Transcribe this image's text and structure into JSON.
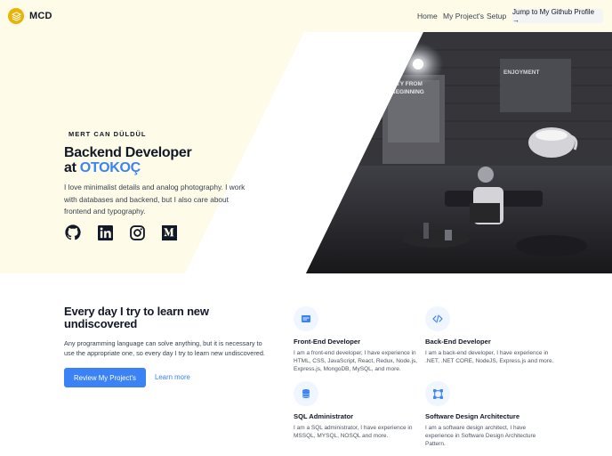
{
  "nav": {
    "logo_text": "MCD",
    "links": [
      "Home",
      "My Project's",
      "Setup"
    ],
    "cta_label": "Jump to My Github Profile →"
  },
  "hero": {
    "eyebrow": "MERT CAN DÜLDÜL",
    "title_line1": "Backend Developer",
    "title_at": "at ",
    "title_company": "OTOKOÇ",
    "description": "I love minimalist details and analog photography. I work with databases and backend, but I also care about frontend and typography.",
    "socials": [
      "github-icon",
      "linkedin-icon",
      "instagram-icon",
      "medium-icon"
    ],
    "photo_signs": {
      "left_line1": "LITY FROM",
      "left_line2": "BEGINNING",
      "right_sign": "ENJOYMENT"
    }
  },
  "section": {
    "title": "Every day I try to learn new undiscovered",
    "description": "Any programming language can solve anything, but it is necessary to use the appropriate one, so every day I try to learn new undiscovered.",
    "primary_button": "Review My Project's",
    "secondary_link": "Learn more",
    "features": [
      {
        "icon": "browser-icon",
        "title": "Front-End Developer",
        "desc": "I am a front-end developer, I have experience in HTML, CSS, JavaScript, React, Redux, Node.js, Express.js, MongoDB, MySQL, and more."
      },
      {
        "icon": "code-icon",
        "title": "Back-End Developer",
        "desc": "I am a back-end developer, I have experience in .NET, .NET CORE, NodeJS, Express.js and more."
      },
      {
        "icon": "database-icon",
        "title": "SQL Administrator",
        "desc": "I am a SQL administrator, I have experience in MSSQL, MYSQL, NOSQL and more."
      },
      {
        "icon": "architecture-icon",
        "title": "Software Design Architecture",
        "desc": "I am a software design architect, I have experience in Software Design Architecture Pattern."
      }
    ]
  },
  "colors": {
    "accent": "#3b82f6",
    "hero_bg": "#fefce8",
    "logo": "#eab308"
  }
}
